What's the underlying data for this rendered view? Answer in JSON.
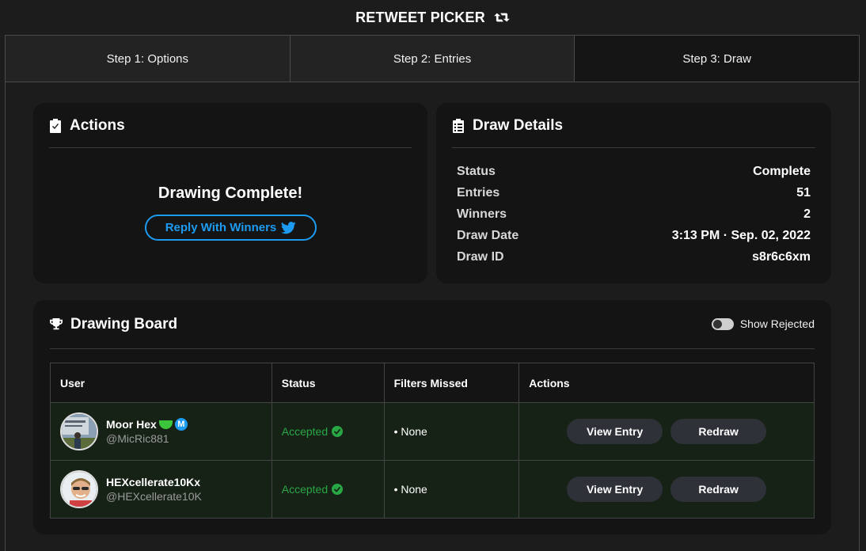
{
  "app": {
    "title": "RETWEET PICKER"
  },
  "tabs": [
    {
      "label": "Step 1: Options"
    },
    {
      "label": "Step 2: Entries"
    },
    {
      "label": "Step 3: Draw"
    }
  ],
  "actions": {
    "title": "Actions",
    "complete_text": "Drawing Complete!",
    "reply_label": "Reply With Winners"
  },
  "details": {
    "title": "Draw Details",
    "rows": [
      {
        "key": "Status",
        "value": "Complete"
      },
      {
        "key": "Entries",
        "value": "51"
      },
      {
        "key": "Winners",
        "value": "2"
      },
      {
        "key": "Draw Date",
        "value": "3:13 PM · Sep. 02, 2022"
      },
      {
        "key": "Draw ID",
        "value": "s8r6c6xm"
      }
    ]
  },
  "board": {
    "title": "Drawing Board",
    "show_rejected_label": "Show Rejected",
    "columns": [
      "User",
      "Status",
      "Filters Missed",
      "Actions"
    ],
    "rows": [
      {
        "name": "Moor Hex",
        "badge_m": "M",
        "handle": "@MicRic881",
        "status": "Accepted",
        "filters": "• None",
        "view_label": "View Entry",
        "redraw_label": "Redraw"
      },
      {
        "name": "HEXcellerate10Kx",
        "handle": "@HEXcellerate10K",
        "status": "Accepted",
        "filters": "• None",
        "view_label": "View Entry",
        "redraw_label": "Redraw"
      }
    ]
  },
  "colors": {
    "accent": "#1d9bf0",
    "success": "#28a745",
    "row_bg": "#172217"
  }
}
